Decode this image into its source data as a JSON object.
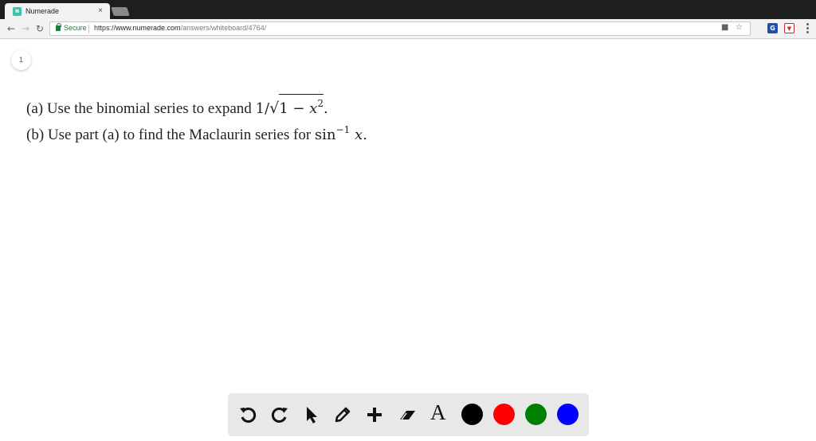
{
  "browser": {
    "tab": {
      "favicon_text": "N",
      "title": "Numerade",
      "close": "×"
    },
    "address": {
      "secure_label": "Secure",
      "url_scheme": "https://",
      "url_host": "www.numerade.com",
      "url_path": "/answers/whiteboard/4764/"
    },
    "extensions": [
      {
        "name": "grammarly-icon",
        "text": "G",
        "color": "#1f4fb0"
      },
      {
        "name": "extension-icon",
        "text": "▼",
        "color": "#c62828"
      }
    ]
  },
  "page": {
    "badge": "1",
    "question_a": {
      "prefix": "(a) Use the binomial series to expand ",
      "expr_lead": "1/",
      "radical": "√",
      "radicand_num": "1 − ",
      "radicand_var": "x",
      "radicand_exp": "2",
      "suffix": "."
    },
    "question_b": {
      "prefix": "(b) Use part (a) to find the Maclaurin series for ",
      "func": "sin",
      "exp": "−1",
      "var": "x",
      "suffix": "."
    }
  },
  "draw_toolbar": {
    "text_tool_label": "A",
    "colors": {
      "black": "#000000",
      "red": "#ff0000",
      "green": "#008000",
      "blue": "#0000ff"
    }
  }
}
